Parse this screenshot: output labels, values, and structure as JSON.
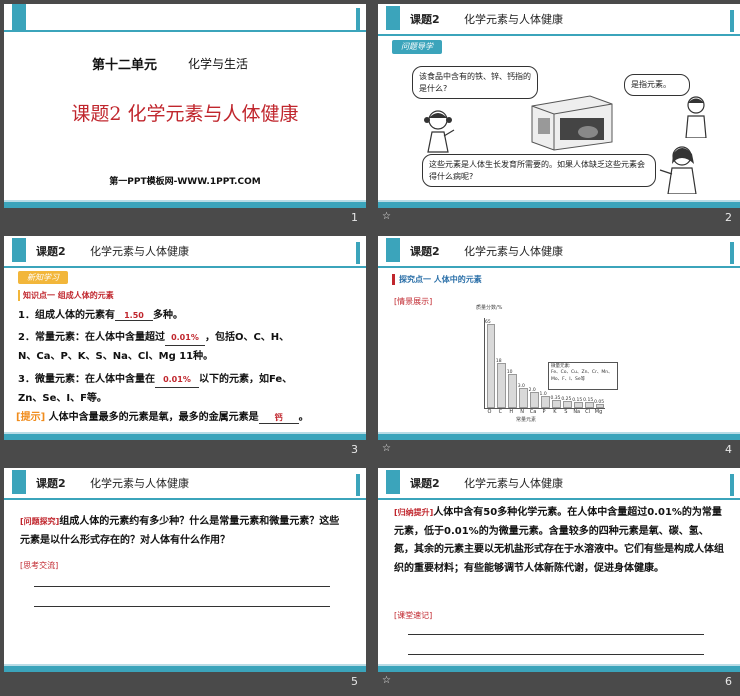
{
  "slide1": {
    "unit": "第十二单元",
    "unit_topic": "化学与生活",
    "title": "课题2  化学元素与人体健康",
    "site": "第一PPT模板网-WWW.1PPT.COM",
    "number": "1"
  },
  "header": {
    "label": "课题2",
    "topic": "化学元素与人体健康"
  },
  "slide2": {
    "badge": "问题导学",
    "q1": "该食品中含有的铁、锌、钙指的是什么?",
    "a1": "是指元素。",
    "q2": "这些元素是人体生长发育所需要的。如果人体缺乏这些元素会得什么病呢?",
    "number": "2"
  },
  "slide3": {
    "badge": "新知学习",
    "kp": "知识点一  组成人体的元素",
    "l1_a": "1．组成人体的元素有",
    "l1_ans": "1.50",
    "l1_b": "多种。",
    "l2_a": "2．常量元素：在人体中含量超过",
    "l2_ans": "0.01%",
    "l2_b": "，包括O、C、H、",
    "l2_c": "N、Ca、P、K、S、Na、Cl、Mg 11种。",
    "l3_a": "3．微量元素：在人体中含量在",
    "l3_ans": "0.01%",
    "l3_b": "以下的元素，如Fe、",
    "l3_c": "Zn、Se、I、F等。",
    "tip_tag": "[提示]",
    "tip_a": "人体中含量最多的元素是氧，最多的金属元素是",
    "tip_ans": "钙",
    "tip_b": "。",
    "number": "3"
  },
  "slide4": {
    "explore": "探究点一  人体中的元素",
    "scene": "[情景展示]",
    "ylabel": "质量分数/%",
    "xlabel": "常量元素",
    "trace_title": "微量元素:",
    "trace_list": "Fe、Co、Cu、Zn、Cr、Mn、Mo、F、I、Se等",
    "number": "4"
  },
  "chart_data": {
    "type": "bar",
    "categories": [
      "O",
      "C",
      "H",
      "N",
      "Ca",
      "P",
      "K",
      "S",
      "Na",
      "Cl",
      "Mg"
    ],
    "values": [
      65,
      18,
      10,
      3,
      2,
      1,
      0.35,
      0.25,
      0.15,
      0.15,
      0.05
    ],
    "labels": [
      "65",
      "18",
      "10",
      "3.0",
      "2.0",
      "1.0",
      "0.35",
      "0.25",
      "0.15",
      "0.15",
      "0.05"
    ],
    "xlabel": "常量元素",
    "ylabel": "质量分数/%"
  },
  "slide5": {
    "tag": "[问题探究]",
    "question": "组成人体的元素约有多少种？什么是常量元素和微量元素？这些元素是以什么形式存在的？对人体有什么作用？",
    "think": "[思考交流]",
    "number": "5"
  },
  "slide6": {
    "tag": "[归纳提升]",
    "summary": "人体中含有50多种化学元素。在人体中含量超过0.01%的为常量元素，低于0.01%的为微量元素。含量较多的四种元素是氧、碳、氢、氮，其余的元素主要以无机盐形式存在于水溶液中。它们有些是构成人体组织的重要材料；有些能够调节人体新陈代谢，促进身体健康。",
    "notes": "[课堂速记]",
    "number": "6"
  },
  "colors": {
    "accent": "#3ba4bb",
    "answer": "#c0262d"
  }
}
